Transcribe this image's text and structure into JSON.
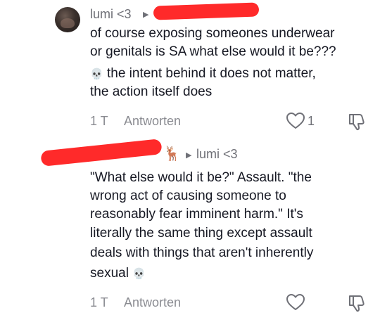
{
  "comment1": {
    "username": "lumi <3",
    "lines": [
      "of course exposing someones underwear",
      "or genitals is SA what else would it be???",
      "the intent behind it does not matter,",
      "the action itself does"
    ],
    "emoji": "💀",
    "time": "1 T",
    "reply_label": "Antworten",
    "like_count": "1"
  },
  "comment2": {
    "reply_to": "lumi <3",
    "badge_emoji": "🦌",
    "lines": [
      "\"What else would it be?\" Assault. \"the",
      "wrong act of causing someone to",
      "reasonably fear imminent harm.\" It's",
      "literally the same thing except assault",
      "deals with things that aren't inherently",
      "sexual"
    ],
    "emoji": "💀",
    "time": "1 T",
    "reply_label": "Antworten"
  },
  "colors": {
    "text": "#161823",
    "muted": "#8a8b91",
    "redaction": "#ff2a2a"
  },
  "icons": [
    "heart-outline-icon",
    "thumbs-down-icon",
    "play-triangle-icon",
    "skull-emoji",
    "deer-emoji"
  ]
}
